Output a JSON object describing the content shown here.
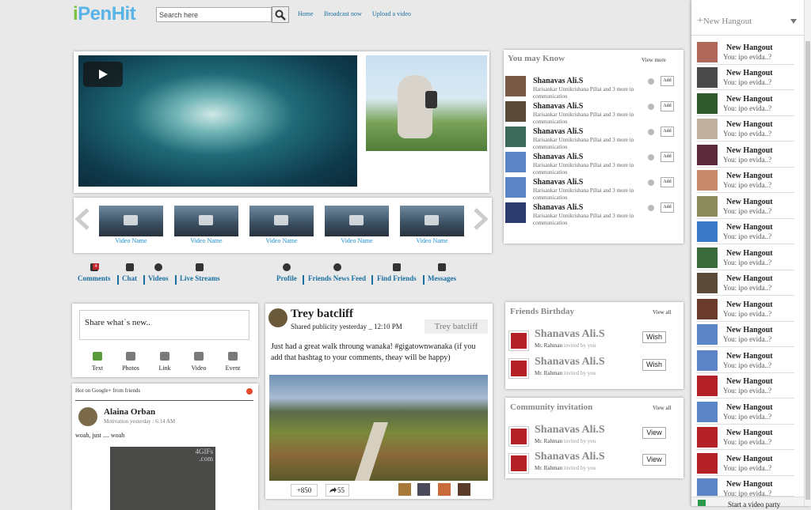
{
  "header": {
    "logo": "PenHit",
    "logo_i": "i",
    "search_placeholder": "Search here",
    "nav": [
      "Home",
      "Broadcast now",
      "Upload a video"
    ]
  },
  "videos": {
    "thumb_label": "Video Name",
    "thumbs": [
      "Video Name",
      "Video Name",
      "Video Name",
      "Video Name",
      "Video Name"
    ]
  },
  "actions": {
    "left": [
      {
        "label": "Comments",
        "icon": "comment-icon",
        "badge": "4"
      },
      {
        "label": "Chat",
        "icon": "chat-icon"
      },
      {
        "label": "Videos",
        "icon": "video-icon"
      },
      {
        "label": "Live Streams",
        "icon": "monitor-icon"
      }
    ],
    "right": [
      {
        "label": "Profile",
        "icon": "user-icon"
      },
      {
        "label": "Friends News Feed",
        "icon": "globe-icon"
      },
      {
        "label": "Find Friends",
        "icon": "people-icon"
      },
      {
        "label": "Messages",
        "icon": "envelope-icon"
      }
    ]
  },
  "may_know": {
    "title": "You may Know",
    "view_more": "View more",
    "items": [
      {
        "name": "Shanavas Ali.S",
        "sub": "Harisankar Unnikrishana Pillai and 3 more in communication",
        "add": "Add"
      },
      {
        "name": "Shanavas Ali.S",
        "sub": "Harisankar Unnikrishana Pillai and 3 more in communication",
        "add": "Add"
      },
      {
        "name": "Shanavas Ali.S",
        "sub": "Harisankar Unnikrishana Pillai and 3 more in communication",
        "add": "Add"
      },
      {
        "name": "Shanavas Ali.S",
        "sub": "Harisankar Unnikrishana Pillai and 3 more in communication",
        "add": "Add"
      },
      {
        "name": "Shanavas Ali.S",
        "sub": "Harisankar Unnikrishana Pillai and 3 more in communication",
        "add": "Add"
      },
      {
        "name": "Shanavas Ali.S",
        "sub": "Harisankar Unnikrishana Pillai and 3 more in communication",
        "add": "Add"
      }
    ]
  },
  "composer": {
    "placeholder": "Share what`s new..",
    "tools": [
      "Text",
      "Photos",
      "Link",
      "Video",
      "Event"
    ]
  },
  "hot": {
    "title": "Hot on Google+ from friends",
    "author": "Alaina Orban",
    "meta": "Motivation yesterday : 6:14 AM",
    "text": "woah, just .... woah",
    "watermark": "4GIFs .com"
  },
  "post": {
    "author": "Trey batcliff",
    "meta": "Shared publicity yesterday _ 12:10 PM",
    "tag": "Trey batcliff",
    "text": "Just had a great walk throung wanaka! #gigatownwanaka (if you add that hashtag to your comments, theay will be happy)",
    "plus": "+850",
    "shares": "55"
  },
  "birthday": {
    "title": "Friends Birthday",
    "view_all": "View all",
    "items": [
      {
        "name": "Shanavas Ali.S",
        "sub_name": "Mr. Rahman",
        "sub": "invited by you",
        "btn": "Wish"
      },
      {
        "name": "Shanavas Ali.S",
        "sub_name": "Mr. Rahman",
        "sub": "invited by you",
        "btn": "Wish"
      }
    ]
  },
  "community": {
    "title": "Community invitation",
    "view_all": "View all",
    "items": [
      {
        "name": "Shanavas Ali.S",
        "sub_name": "Mr. Rahman",
        "sub": "invited by you",
        "btn": "View"
      },
      {
        "name": "Shanavas Ali.S",
        "sub_name": "Mr. Rahman",
        "sub": "invited by you",
        "btn": "View"
      }
    ]
  },
  "hangouts": {
    "title": "New Hangout",
    "items": [
      {
        "name": "New Hangout",
        "sub": "You: ipo evida..?"
      },
      {
        "name": "New Hangout",
        "sub": "You: ipo evida..?"
      },
      {
        "name": "New Hangout",
        "sub": "You: ipo evida..?"
      },
      {
        "name": "New Hangout",
        "sub": "You: ipo evida..?"
      },
      {
        "name": "New Hangout",
        "sub": "You: ipo evida..?"
      },
      {
        "name": "New Hangout",
        "sub": "You: ipo evida..?"
      },
      {
        "name": "New Hangout",
        "sub": "You: ipo evida..?"
      },
      {
        "name": "New Hangout",
        "sub": "You: ipo evida..?"
      },
      {
        "name": "New Hangout",
        "sub": "You: ipo evida..?"
      },
      {
        "name": "New Hangout",
        "sub": "You: ipo evida..?"
      },
      {
        "name": "New Hangout",
        "sub": "You: ipo evida..?"
      },
      {
        "name": "New Hangout",
        "sub": "You: ipo evida..?"
      },
      {
        "name": "New Hangout",
        "sub": "You: ipo evida..?"
      },
      {
        "name": "New Hangout",
        "sub": "You: ipo evida..?"
      },
      {
        "name": "New Hangout",
        "sub": "You: ipo evida..?"
      },
      {
        "name": "New Hangout",
        "sub": "You: ipo evida..?"
      },
      {
        "name": "New Hangout",
        "sub": "You: ipo evida..?"
      },
      {
        "name": "New Hangout",
        "sub": "You: ipo evida..?"
      }
    ],
    "footer": "Start a video party"
  }
}
